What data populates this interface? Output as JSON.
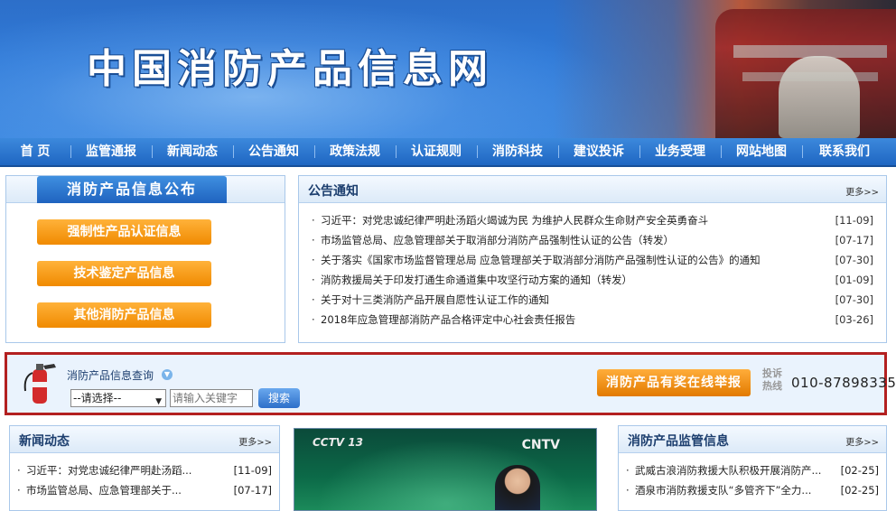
{
  "banner": {
    "title": "中国消防产品信息网"
  },
  "nav": [
    "首 页",
    "监管通报",
    "新闻动态",
    "公告通知",
    "政策法规",
    "认证规则",
    "消防科技",
    "建议投诉",
    "业务受理",
    "网站地图",
    "联系我们"
  ],
  "info_box": {
    "title": "消防产品信息公布",
    "buttons": [
      "强制性产品认证信息",
      "技术鉴定产品信息",
      "其他消防产品信息"
    ]
  },
  "notice": {
    "title": "公告通知",
    "more": "更多>>",
    "items": [
      {
        "title": "习近平：对党忠诚纪律严明赴汤蹈火竭诚为民 为维护人民群众生命财产安全英勇奋斗",
        "date": "[11-09]"
      },
      {
        "title": "市场监管总局、应急管理部关于取消部分消防产品强制性认证的公告（转发）",
        "date": "[07-17]"
      },
      {
        "title": "关于落实《国家市场监督管理总局 应急管理部关于取消部分消防产品强制性认证的公告》的通知",
        "date": "[07-30]"
      },
      {
        "title": "消防救援局关于印发打通生命通道集中攻坚行动方案的通知（转发）",
        "date": "[01-09]"
      },
      {
        "title": "关于对十三类消防产品开展自愿性认证工作的通知",
        "date": "[07-30]"
      },
      {
        "title": "2018年应急管理部消防产品合格评定中心社会责任报告",
        "date": "[03-26]"
      }
    ]
  },
  "search": {
    "label": "消防产品信息查询",
    "select_value": "--请选择--",
    "keyword_placeholder": "请输入关键字",
    "button": "搜索",
    "report_button": "消防产品有奖在线举报",
    "hotline_label": "投诉热线",
    "hotline_number": "010-87898335"
  },
  "news": {
    "title": "新闻动态",
    "more": "更多>>",
    "items": [
      {
        "title": "习近平：对党忠诚纪律严明赴汤蹈...",
        "date": "[11-09]"
      },
      {
        "title": "市场监管总局、应急管理部关于...",
        "date": "[07-17]"
      }
    ]
  },
  "supervision": {
    "title": "消防产品监管信息",
    "more": "更多>>",
    "items": [
      {
        "title": "武威古浪消防救援大队积极开展消防产...",
        "date": "[02-25]"
      },
      {
        "title": "酒泉市消防救援支队“多管齐下”全力...",
        "date": "[02-25]"
      }
    ]
  },
  "video": {
    "logo_left": "CCTV 13",
    "logo_right": "CNTV"
  }
}
